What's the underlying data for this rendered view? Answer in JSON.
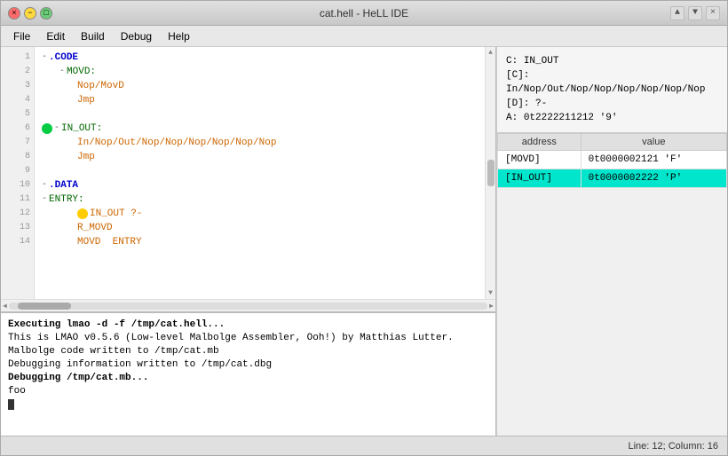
{
  "window": {
    "title": "cat.hell - HeLL IDE",
    "buttons": {
      "close": "×",
      "minimize": "−",
      "maximize": "□"
    }
  },
  "menu": {
    "items": [
      "File",
      "Edit",
      "Build",
      "Debug",
      "Help"
    ]
  },
  "editor": {
    "lines": [
      {
        "num": "1",
        "indent": 0,
        "collapse": "-",
        "text": ".CODE",
        "type": "section"
      },
      {
        "num": "2",
        "indent": 1,
        "collapse": "-",
        "text": "MOVD:",
        "type": "label"
      },
      {
        "num": "3",
        "indent": 2,
        "collapse": "",
        "text": "Nop/MovD",
        "type": "instr"
      },
      {
        "num": "4",
        "indent": 2,
        "collapse": "",
        "text": "Jmp",
        "type": "instr"
      },
      {
        "num": "5",
        "indent": 0,
        "collapse": "",
        "text": "",
        "type": "blank"
      },
      {
        "num": "6",
        "indent": 0,
        "collapse": "-",
        "text": "IN_OUT:",
        "type": "label",
        "marker": "green"
      },
      {
        "num": "7",
        "indent": 2,
        "collapse": "",
        "text": "In/Nop/Out/Nop/Nop/Nop/Nop/Nop/Nop",
        "type": "instr"
      },
      {
        "num": "8",
        "indent": 2,
        "collapse": "",
        "text": "Jmp",
        "type": "instr"
      },
      {
        "num": "9",
        "indent": 0,
        "collapse": "",
        "text": "",
        "type": "blank"
      },
      {
        "num": "10",
        "indent": 0,
        "collapse": "-",
        "text": ".DATA",
        "type": "section"
      },
      {
        "num": "11",
        "indent": 0,
        "collapse": "-",
        "text": "ENTRY:",
        "type": "label"
      },
      {
        "num": "12",
        "indent": 2,
        "collapse": "",
        "text": "IN_OUT ?-",
        "type": "instr",
        "marker": "yellow"
      },
      {
        "num": "13",
        "indent": 2,
        "collapse": "",
        "text": "R_MOVD",
        "type": "instr"
      },
      {
        "num": "14",
        "indent": 2,
        "collapse": "",
        "text": "MOVD  ENTRY",
        "type": "instr"
      }
    ]
  },
  "debug_info": {
    "c_label": "C:",
    "c_value": "IN_OUT",
    "c_detail_label": "[C]:",
    "c_detail_value": "In/Nop/Out/Nop/Nop/Nop/Nop/Nop/Nop",
    "d_label": "[D]:",
    "d_value": "?-",
    "a_label": "A:",
    "a_value": "0t2222211212 '9'"
  },
  "register_table": {
    "headers": [
      "address",
      "value"
    ],
    "rows": [
      {
        "address": "[MOVD]",
        "value": "0t0000002121 'F'",
        "highlighted": false
      },
      {
        "address": "[IN_OUT]",
        "value": "0t0000002222 'P'",
        "highlighted": true
      }
    ]
  },
  "terminal": {
    "lines": [
      {
        "text": "Executing lmao -d -f /tmp/cat.hell...",
        "bold": true
      },
      {
        "text": "This is LMAO v0.5.6 (Low-level Malbolge Assembler, Ooh!) by Matthias Lutter.",
        "bold": false
      },
      {
        "text": "Malbolge code written to /tmp/cat.mb",
        "bold": false
      },
      {
        "text": "Debugging information written to /tmp/cat.dbg",
        "bold": false
      },
      {
        "text": "Debugging /tmp/cat.mb...",
        "bold": true
      },
      {
        "text": "foo",
        "bold": false
      }
    ]
  },
  "status_bar": {
    "text": "Line: 12; Column: 16"
  }
}
